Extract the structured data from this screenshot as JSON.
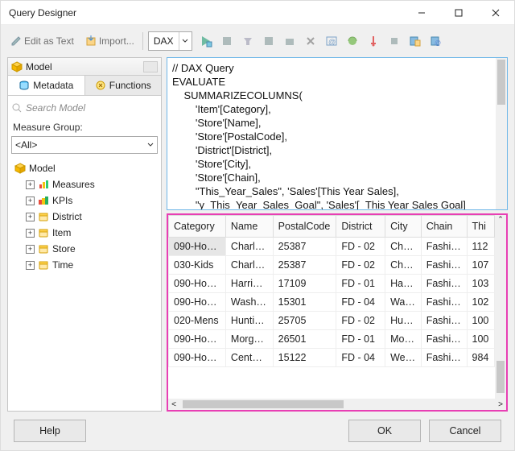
{
  "title": "Query Designer",
  "toolbar": {
    "edit_as_text": "Edit as Text",
    "import": "Import...",
    "lang_dropdown": "DAX"
  },
  "left": {
    "model_header": "Model",
    "tabs": {
      "metadata": "Metadata",
      "functions": "Functions"
    },
    "search_placeholder": "Search Model",
    "measure_group_label": "Measure Group:",
    "measure_group_value": "<All>",
    "tree": [
      {
        "label": "Model",
        "icon": "cube",
        "expandable": false,
        "root": true
      },
      {
        "label": "Measures",
        "icon": "bars"
      },
      {
        "label": "KPIs",
        "icon": "kpis"
      },
      {
        "label": "District",
        "icon": "dim"
      },
      {
        "label": "Item",
        "icon": "dim"
      },
      {
        "label": "Store",
        "icon": "dim"
      },
      {
        "label": "Time",
        "icon": "dim"
      }
    ]
  },
  "query": "// DAX Query\nEVALUATE\n    SUMMARIZECOLUMNS(\n        'Item'[Category],\n        'Store'[Name],\n        'Store'[PostalCode],\n        'District'[District],\n        'Store'[City],\n        'Store'[Chain],\n        \"This_Year_Sales\", 'Sales'[This Year Sales],\n        \"y_This_Year_Sales_Goal\", 'Sales'[_This Year Sales Goal]",
  "grid": {
    "columns": [
      "Category",
      "Name",
      "PostalCode",
      "District",
      "City",
      "Chain",
      "Thi"
    ],
    "rows": [
      [
        "090-Ho…",
        "Charl…",
        "25387",
        "FD - 02",
        "Ch…",
        "Fashi…",
        "112"
      ],
      [
        "030-Kids",
        "Charl…",
        "25387",
        "FD - 02",
        "Ch…",
        "Fashi…",
        "107"
      ],
      [
        "090-Ho…",
        "Harri…",
        "17109",
        "FD - 01",
        "Ha…",
        "Fashi…",
        "103"
      ],
      [
        "090-Ho…",
        "Wash…",
        "15301",
        "FD - 04",
        "Wa…",
        "Fashi…",
        "102"
      ],
      [
        "020-Mens",
        "Hunti…",
        "25705",
        "FD - 02",
        "Hu…",
        "Fashi…",
        "100"
      ],
      [
        "090-Ho…",
        "Morg…",
        "26501",
        "FD - 01",
        "Mo…",
        "Fashi…",
        "100"
      ],
      [
        "090-Ho…",
        "Cent…",
        "15122",
        "FD - 04",
        "We…",
        "Fashi…",
        "984"
      ]
    ]
  },
  "footer": {
    "help": "Help",
    "ok": "OK",
    "cancel": "Cancel"
  }
}
